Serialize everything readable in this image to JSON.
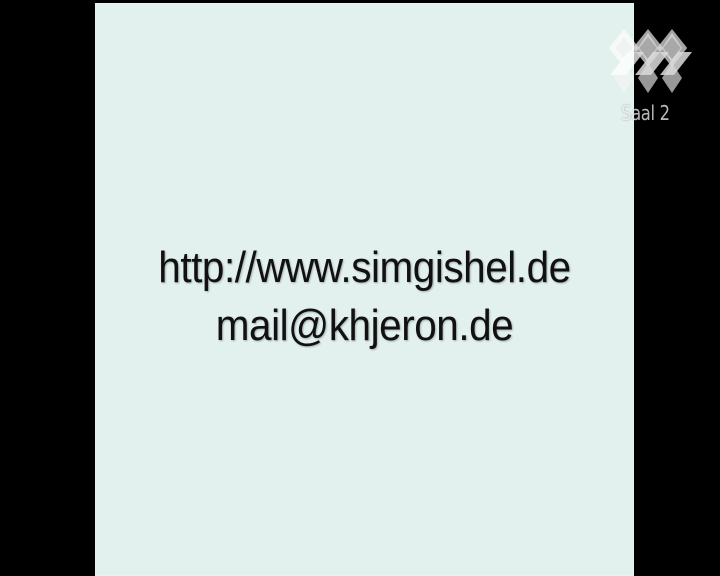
{
  "slide": {
    "lines": [
      "http://www.simgishel.de",
      "mail@khjeron.de"
    ]
  },
  "channel": {
    "logo_icon": "channel-logo-icon",
    "caption": "Saal 2"
  },
  "colors": {
    "frame": "#000000",
    "slide_background": "#e3f1ee",
    "slide_text": "#111111",
    "logo": "#f2f2f2"
  }
}
